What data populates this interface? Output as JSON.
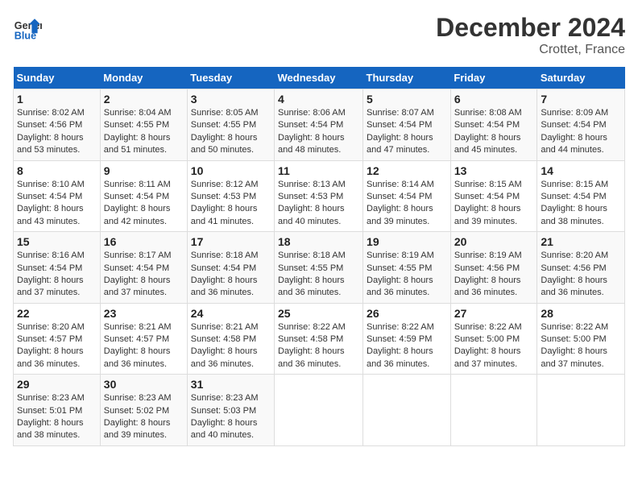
{
  "header": {
    "logo_line1": "General",
    "logo_line2": "Blue",
    "title": "December 2024",
    "subtitle": "Crottet, France"
  },
  "columns": [
    "Sunday",
    "Monday",
    "Tuesday",
    "Wednesday",
    "Thursday",
    "Friday",
    "Saturday"
  ],
  "weeks": [
    [
      {
        "day": "1",
        "info": "Sunrise: 8:02 AM\nSunset: 4:56 PM\nDaylight: 8 hours\nand 53 minutes."
      },
      {
        "day": "2",
        "info": "Sunrise: 8:04 AM\nSunset: 4:55 PM\nDaylight: 8 hours\nand 51 minutes."
      },
      {
        "day": "3",
        "info": "Sunrise: 8:05 AM\nSunset: 4:55 PM\nDaylight: 8 hours\nand 50 minutes."
      },
      {
        "day": "4",
        "info": "Sunrise: 8:06 AM\nSunset: 4:54 PM\nDaylight: 8 hours\nand 48 minutes."
      },
      {
        "day": "5",
        "info": "Sunrise: 8:07 AM\nSunset: 4:54 PM\nDaylight: 8 hours\nand 47 minutes."
      },
      {
        "day": "6",
        "info": "Sunrise: 8:08 AM\nSunset: 4:54 PM\nDaylight: 8 hours\nand 45 minutes."
      },
      {
        "day": "7",
        "info": "Sunrise: 8:09 AM\nSunset: 4:54 PM\nDaylight: 8 hours\nand 44 minutes."
      }
    ],
    [
      {
        "day": "8",
        "info": "Sunrise: 8:10 AM\nSunset: 4:54 PM\nDaylight: 8 hours\nand 43 minutes."
      },
      {
        "day": "9",
        "info": "Sunrise: 8:11 AM\nSunset: 4:54 PM\nDaylight: 8 hours\nand 42 minutes."
      },
      {
        "day": "10",
        "info": "Sunrise: 8:12 AM\nSunset: 4:53 PM\nDaylight: 8 hours\nand 41 minutes."
      },
      {
        "day": "11",
        "info": "Sunrise: 8:13 AM\nSunset: 4:53 PM\nDaylight: 8 hours\nand 40 minutes."
      },
      {
        "day": "12",
        "info": "Sunrise: 8:14 AM\nSunset: 4:54 PM\nDaylight: 8 hours\nand 39 minutes."
      },
      {
        "day": "13",
        "info": "Sunrise: 8:15 AM\nSunset: 4:54 PM\nDaylight: 8 hours\nand 39 minutes."
      },
      {
        "day": "14",
        "info": "Sunrise: 8:15 AM\nSunset: 4:54 PM\nDaylight: 8 hours\nand 38 minutes."
      }
    ],
    [
      {
        "day": "15",
        "info": "Sunrise: 8:16 AM\nSunset: 4:54 PM\nDaylight: 8 hours\nand 37 minutes."
      },
      {
        "day": "16",
        "info": "Sunrise: 8:17 AM\nSunset: 4:54 PM\nDaylight: 8 hours\nand 37 minutes."
      },
      {
        "day": "17",
        "info": "Sunrise: 8:18 AM\nSunset: 4:54 PM\nDaylight: 8 hours\nand 36 minutes."
      },
      {
        "day": "18",
        "info": "Sunrise: 8:18 AM\nSunset: 4:55 PM\nDaylight: 8 hours\nand 36 minutes."
      },
      {
        "day": "19",
        "info": "Sunrise: 8:19 AM\nSunset: 4:55 PM\nDaylight: 8 hours\nand 36 minutes."
      },
      {
        "day": "20",
        "info": "Sunrise: 8:19 AM\nSunset: 4:56 PM\nDaylight: 8 hours\nand 36 minutes."
      },
      {
        "day": "21",
        "info": "Sunrise: 8:20 AM\nSunset: 4:56 PM\nDaylight: 8 hours\nand 36 minutes."
      }
    ],
    [
      {
        "day": "22",
        "info": "Sunrise: 8:20 AM\nSunset: 4:57 PM\nDaylight: 8 hours\nand 36 minutes."
      },
      {
        "day": "23",
        "info": "Sunrise: 8:21 AM\nSunset: 4:57 PM\nDaylight: 8 hours\nand 36 minutes."
      },
      {
        "day": "24",
        "info": "Sunrise: 8:21 AM\nSunset: 4:58 PM\nDaylight: 8 hours\nand 36 minutes."
      },
      {
        "day": "25",
        "info": "Sunrise: 8:22 AM\nSunset: 4:58 PM\nDaylight: 8 hours\nand 36 minutes."
      },
      {
        "day": "26",
        "info": "Sunrise: 8:22 AM\nSunset: 4:59 PM\nDaylight: 8 hours\nand 36 minutes."
      },
      {
        "day": "27",
        "info": "Sunrise: 8:22 AM\nSunset: 5:00 PM\nDaylight: 8 hours\nand 37 minutes."
      },
      {
        "day": "28",
        "info": "Sunrise: 8:22 AM\nSunset: 5:00 PM\nDaylight: 8 hours\nand 37 minutes."
      }
    ],
    [
      {
        "day": "29",
        "info": "Sunrise: 8:23 AM\nSunset: 5:01 PM\nDaylight: 8 hours\nand 38 minutes."
      },
      {
        "day": "30",
        "info": "Sunrise: 8:23 AM\nSunset: 5:02 PM\nDaylight: 8 hours\nand 39 minutes."
      },
      {
        "day": "31",
        "info": "Sunrise: 8:23 AM\nSunset: 5:03 PM\nDaylight: 8 hours\nand 40 minutes."
      },
      null,
      null,
      null,
      null
    ]
  ]
}
